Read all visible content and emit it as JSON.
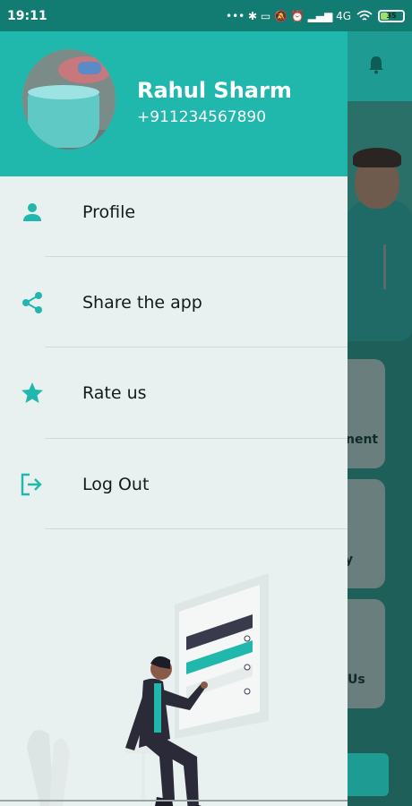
{
  "status_bar": {
    "time": "19:11",
    "indicators": "••• ✱ ▭ 🔕 ⏰ ▂▄▆ 4G",
    "battery": "35"
  },
  "drawer": {
    "user": {
      "name": "Rahul Sharm",
      "phone": "+911234567890"
    },
    "menu": [
      {
        "label": "Profile",
        "icon": "person-icon"
      },
      {
        "label": "Share the app",
        "icon": "share-icon"
      },
      {
        "label": "Rate us",
        "icon": "star-icon"
      },
      {
        "label": "Log Out",
        "icon": "logout-icon"
      }
    ]
  },
  "background_app": {
    "tiles": [
      "nent",
      "y",
      "Us"
    ]
  },
  "colors": {
    "accent": "#20b7ac",
    "drawer_bg": "#e9f0f0"
  }
}
